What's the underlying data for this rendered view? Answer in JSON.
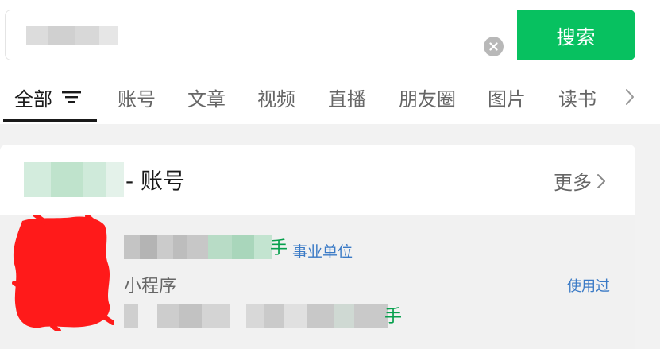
{
  "colors": {
    "brand_green": "#07c160",
    "link_blue": "#3a7ac6",
    "tab_active": "#1a1a1a",
    "tab_inactive": "#666666"
  },
  "search": {
    "button_label": "搜索",
    "clear_icon": "clear-circle-icon"
  },
  "tabs": {
    "items": [
      {
        "label": "全部"
      },
      {
        "label": "账号"
      },
      {
        "label": "文章"
      },
      {
        "label": "视频"
      },
      {
        "label": "直播"
      },
      {
        "label": "朋友圈"
      },
      {
        "label": "图片"
      },
      {
        "label": "读书"
      }
    ],
    "active_index": 0,
    "filter_icon": "filter-lines-icon",
    "more_icon": "chevron-right-icon"
  },
  "accounts_card": {
    "title_suffix": "- 账号",
    "more_label": "更多",
    "result": {
      "name_tail": "手",
      "badge": "事业单位",
      "type_label": "小程序",
      "used_label": "使用过",
      "desc_tail": "手"
    }
  }
}
